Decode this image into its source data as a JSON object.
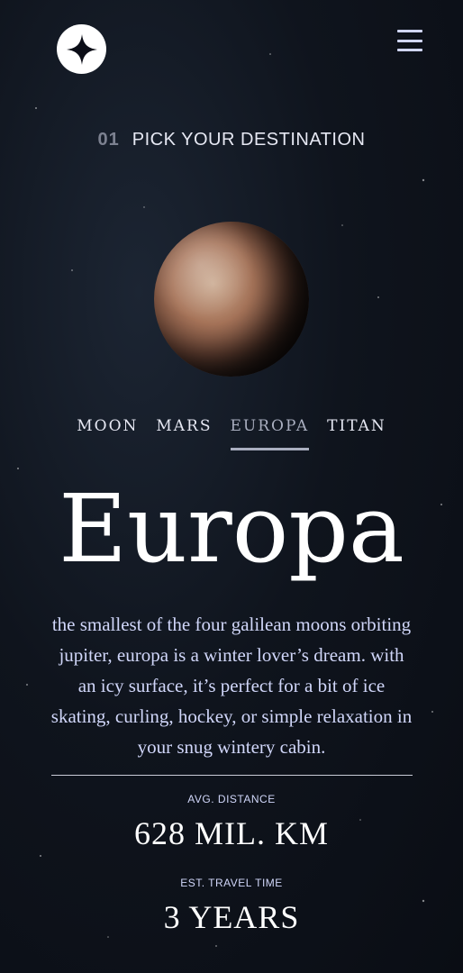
{
  "header": {
    "logo_icon": "four-point-star-icon",
    "menu_icon": "hamburger-menu-icon"
  },
  "page_heading": {
    "number": "01",
    "title": "PICK YOUR DESTINATION"
  },
  "tabs": [
    {
      "label": "MOON",
      "active": false
    },
    {
      "label": "MARS",
      "active": false
    },
    {
      "label": "EUROPA",
      "active": true
    },
    {
      "label": "TITAN",
      "active": false
    }
  ],
  "destination": {
    "name": "Europa",
    "description": "the smallest of the four galilean moons orbiting jupiter, europa is a winter lover’s dream. with an icy surface, it’s perfect for a bit of ice skating, curling, hockey, or simple relaxation in your snug wintery cabin.",
    "distance_label": "AVG. DISTANCE",
    "distance_value": "628 MIL. KM",
    "travel_label": "EST. TRAVEL TIME",
    "travel_value": "3 YEARS"
  },
  "colors": {
    "background": "#0b0d17",
    "accent": "#d0d6f9",
    "text": "#ffffff"
  }
}
